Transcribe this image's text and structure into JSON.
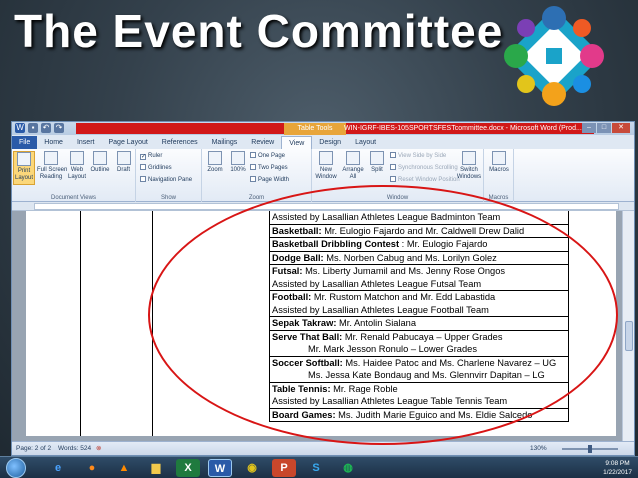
{
  "slide": {
    "title": "The Event Committee"
  },
  "window": {
    "title": "WIN-IGRF-IBES-105SPORTSFESTcommittee.docx - Microsoft Word (Prod...",
    "context_tab": "Table Tools",
    "controls": [
      "–",
      "□",
      "✕"
    ]
  },
  "ribbon": {
    "tabs": [
      "File",
      "Home",
      "Insert",
      "Page Layout",
      "References",
      "Mailings",
      "Review",
      "View",
      "Design",
      "Layout"
    ],
    "active_tab": "View",
    "document_views": {
      "label": "Document Views",
      "buttons": [
        "Print\nLayout",
        "Full Screen\nReading",
        "Web\nLayout",
        "Outline",
        "Draft"
      ]
    },
    "show": {
      "label": "Show",
      "ruler": "Ruler",
      "gridlines": "Gridlines",
      "navigation": "Navigation Pane"
    },
    "zoom": {
      "label": "Zoom",
      "zoom": "Zoom",
      "hundred": "100%",
      "one_page": "One Page",
      "two_pages": "Two Pages",
      "page_width": "Page Width"
    },
    "window": {
      "label": "Window",
      "new_window": "New\nWindow",
      "arrange_all": "Arrange\nAll",
      "split": "Split",
      "view_side": "View Side by Side",
      "sync_scroll": "Synchronous Scrolling",
      "reset_pos": "Reset Window Position",
      "switch": "Switch\nWindows"
    },
    "macros": {
      "label": "Macros",
      "button": "Macros"
    }
  },
  "document": {
    "rows": [
      {
        "lines": [
          {
            "plain": "Assisted by Lasallian Athletes League Badminton Team"
          }
        ]
      },
      {
        "lines": [
          {
            "bold": "Basketball:",
            "plain": " Mr. Eulogio Fajardo and Mr. Caldwell Drew Dalid"
          }
        ]
      },
      {
        "lines": [
          {
            "bold": "Basketball Dribbling Contest",
            "plain": " : Mr. Eulogio Fajardo"
          }
        ]
      },
      {
        "lines": [
          {
            "bold": "Dodge Ball:",
            "plain": " Ms. Norben Cabug and Ms. Lorilyn Golez"
          }
        ]
      },
      {
        "lines": [
          {
            "bold": "Futsal:",
            "plain": " Ms. Liberty Jumamil and Ms. Jenny Rose Ongos"
          },
          {
            "plain": "Assisted by Lasallian Athletes League Futsal Team"
          }
        ]
      },
      {
        "lines": [
          {
            "bold": "Football:",
            "plain": " Mr. Rustom Matchon and Mr. Edd Labastida"
          },
          {
            "plain": "Assisted by Lasallian Athletes League Football Team"
          }
        ]
      },
      {
        "lines": [
          {
            "bold": "Sepak Takraw:",
            "plain": " Mr. Antolin Sialana"
          }
        ]
      },
      {
        "lines": [
          {
            "bold": "Serve That Ball:",
            "plain": " Mr. Renald Pabucaya – Upper Grades"
          },
          {
            "plain": "Mr. Mark Jesson Ronulo – Lower Grades",
            "indent": true
          }
        ]
      },
      {
        "lines": [
          {
            "bold": "Soccer Softball:",
            "plain": " Ms. Haidee Patoc and Ms. Charlene Navarez – UG"
          },
          {
            "plain": "Ms. Jessa Kate Bondaug and Ms. Glennvirr Dapitan – LG",
            "indent": true
          }
        ]
      },
      {
        "lines": [
          {
            "bold": "Table Tennis:",
            "plain": "  Mr. Rage Roble"
          },
          {
            "plain": "Assisted by Lasallian Athletes League Table Tennis Team"
          }
        ]
      },
      {
        "lines": [
          {
            "bold": "Board Games:",
            "plain": " Ms. Judith Marie Eguico and Ms.  Eldie Salcedo"
          }
        ]
      }
    ]
  },
  "status": {
    "page": "Page: 2 of 2",
    "words": "Words: 524",
    "zoom": "130%"
  },
  "taskbar": {
    "time": "9:08 PM",
    "date": "1/22/2017",
    "apps": [
      "IE",
      "Firefox",
      "VLC",
      "Explorer",
      "Excel",
      "Word",
      "Chrome",
      "PowerPoint",
      "Skype",
      "Spotify"
    ]
  },
  "colors": {
    "annotation": "#d81515",
    "ribbon_file": "#2a5aa8",
    "title_band": "#d11818"
  }
}
